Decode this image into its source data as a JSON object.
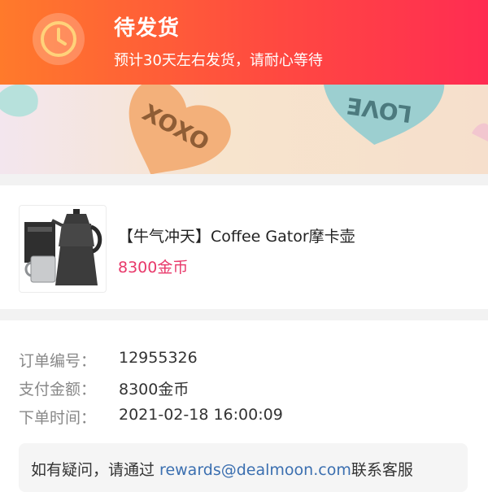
{
  "header": {
    "status_title": "待发货",
    "status_subtitle": "预计30天左右发货，请耐心等待",
    "gradient_start": "#ff7a2b",
    "gradient_end": "#ff2c52",
    "icon": "clock-icon"
  },
  "banner": {
    "texts": [
      "XOXO",
      "LOVE"
    ],
    "colors": {
      "orange_heart": "#f3b07a",
      "blue_heart": "#9ccfd0",
      "pink_heart": "#b7e1dc"
    }
  },
  "product": {
    "name": "【牛气冲天】Coffee Gator摩卡壶",
    "price": "8300金币",
    "price_color": "#e8386a",
    "image_icon": "moka-pot-image"
  },
  "order": {
    "rows": [
      {
        "label": "订单编号：",
        "value": "12955326"
      },
      {
        "label": "支付金额：",
        "value": "8300金币"
      },
      {
        "label": "下单时间：",
        "value": "2021-02-18 16:00:09"
      }
    ]
  },
  "help": {
    "prefix": "如有疑问，请通过 ",
    "email": "rewards@dealmoon.com",
    "suffix": "联系客服",
    "email_color": "#3b6fb0"
  }
}
